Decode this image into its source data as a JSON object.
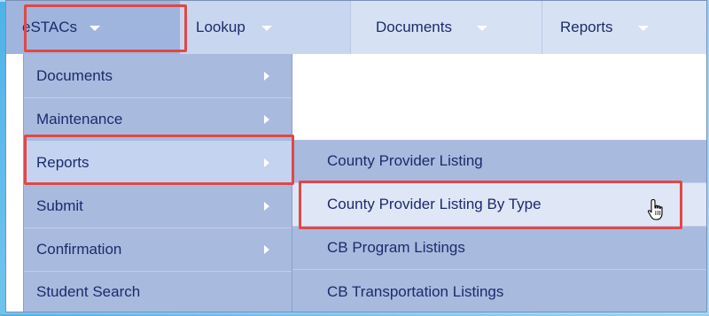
{
  "menubar": {
    "items": [
      {
        "label": "eSTACs"
      },
      {
        "label": "Lookup"
      },
      {
        "label": "Documents"
      },
      {
        "label": "Reports"
      }
    ]
  },
  "estacs_menu": {
    "items": [
      {
        "label": "Documents",
        "has_submenu": true
      },
      {
        "label": "Maintenance",
        "has_submenu": true
      },
      {
        "label": "Reports",
        "has_submenu": true,
        "active": true
      },
      {
        "label": "Submit",
        "has_submenu": true
      },
      {
        "label": "Confirmation",
        "has_submenu": true
      },
      {
        "label": "Student Search",
        "has_submenu": false
      }
    ]
  },
  "reports_submenu": {
    "items": [
      {
        "label": "County Provider Listing"
      },
      {
        "label": "County Provider Listing By Type",
        "hovered": true
      },
      {
        "label": "CB Program Listings"
      },
      {
        "label": "CB Transportation Listings"
      }
    ]
  },
  "colors": {
    "menubar_bg": "#c9d6ef",
    "menu_bg": "#a9badf",
    "highlight_border": "#e04848",
    "text": "#1a2c6b"
  }
}
